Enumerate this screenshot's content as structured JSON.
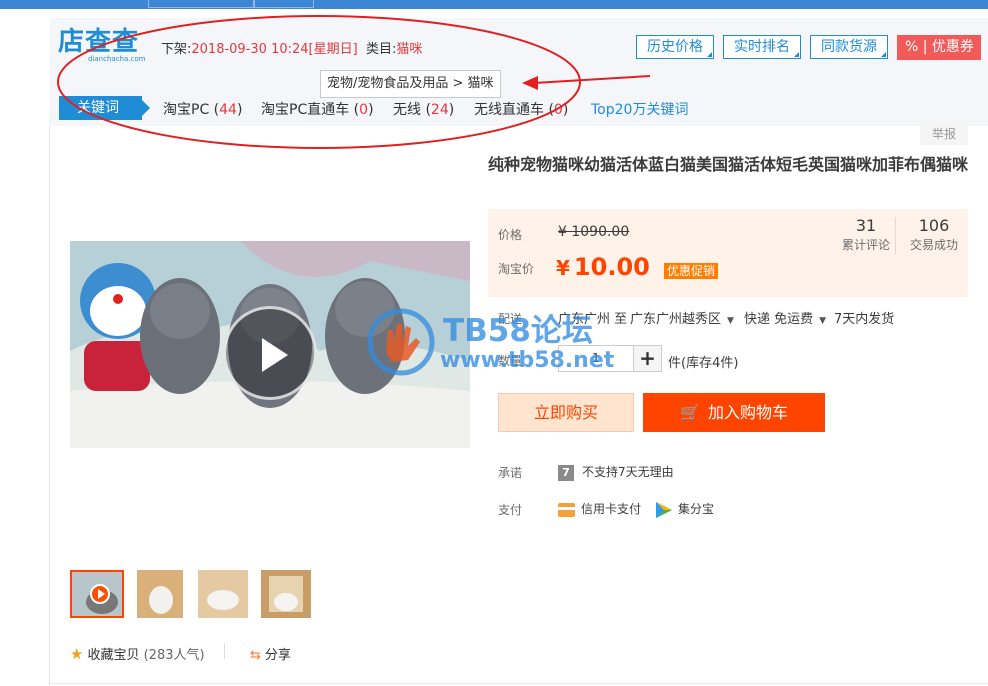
{
  "plugin": {
    "logo_text": "店查查",
    "logo_sub": "dianchacha.com",
    "listed_label": "下架:",
    "listed_time": "2018-09-30 10:24",
    "listed_weekday": "[星期日]",
    "category_label": "类目:",
    "category_value": "猫咪",
    "breadcrumb": "宠物/宠物食品及用品 > 猫咪",
    "buttons": [
      "历史价格",
      "实时排名",
      "同款货源"
    ],
    "coupon_label": "% | 优惠券",
    "keywords_tab": "关键词",
    "keywords": [
      {
        "label": "淘宝PC",
        "count": "44"
      },
      {
        "label": "淘宝PC直通车",
        "count": "0"
      },
      {
        "label": "无线",
        "count": "24"
      },
      {
        "label": "无线直通车",
        "count": "0"
      }
    ],
    "top_link": "Top20万关键词",
    "accent_color": "#1f8dd6",
    "highlight_color": "#e4393c"
  },
  "product": {
    "report": "举报",
    "title": "纯种宠物猫咪幼猫活体蓝白猫美国猫活体短毛英国猫咪加菲布偶猫咪",
    "price_label": "价格",
    "original_price": "¥ 1090.00",
    "taobao_price_label": "淘宝价",
    "currency": "¥",
    "sale_price": "10.00",
    "promo_tag": "优惠促销",
    "reviews_count": "31",
    "reviews_label": "累计评论",
    "sales_count": "106",
    "sales_label": "交易成功",
    "ship_label": "配送",
    "ship_from": "广东广州 至",
    "ship_to": "广东广州越秀区",
    "ship_method": "快递 免运费",
    "ship_time": "7天内发货",
    "qty_label": "数量",
    "qty_value": "1",
    "qty_plus": "+",
    "stock": "件(库存4件)",
    "buy_now": "立即购买",
    "add_cart": "加入购物车",
    "promise_label": "承诺",
    "promise_value": "不支持7天无理由",
    "promise_icon_glyph": "7",
    "pay_label": "支付",
    "pay_methods": [
      "信用卡支付",
      "集分宝"
    ],
    "favorite_label": "收藏宝贝",
    "favorite_count": "(283人气)",
    "share_label": "分享",
    "brand_color": "#ff4400"
  },
  "watermark": {
    "line1": "TB58论坛",
    "line2": "www.tb58.net"
  }
}
